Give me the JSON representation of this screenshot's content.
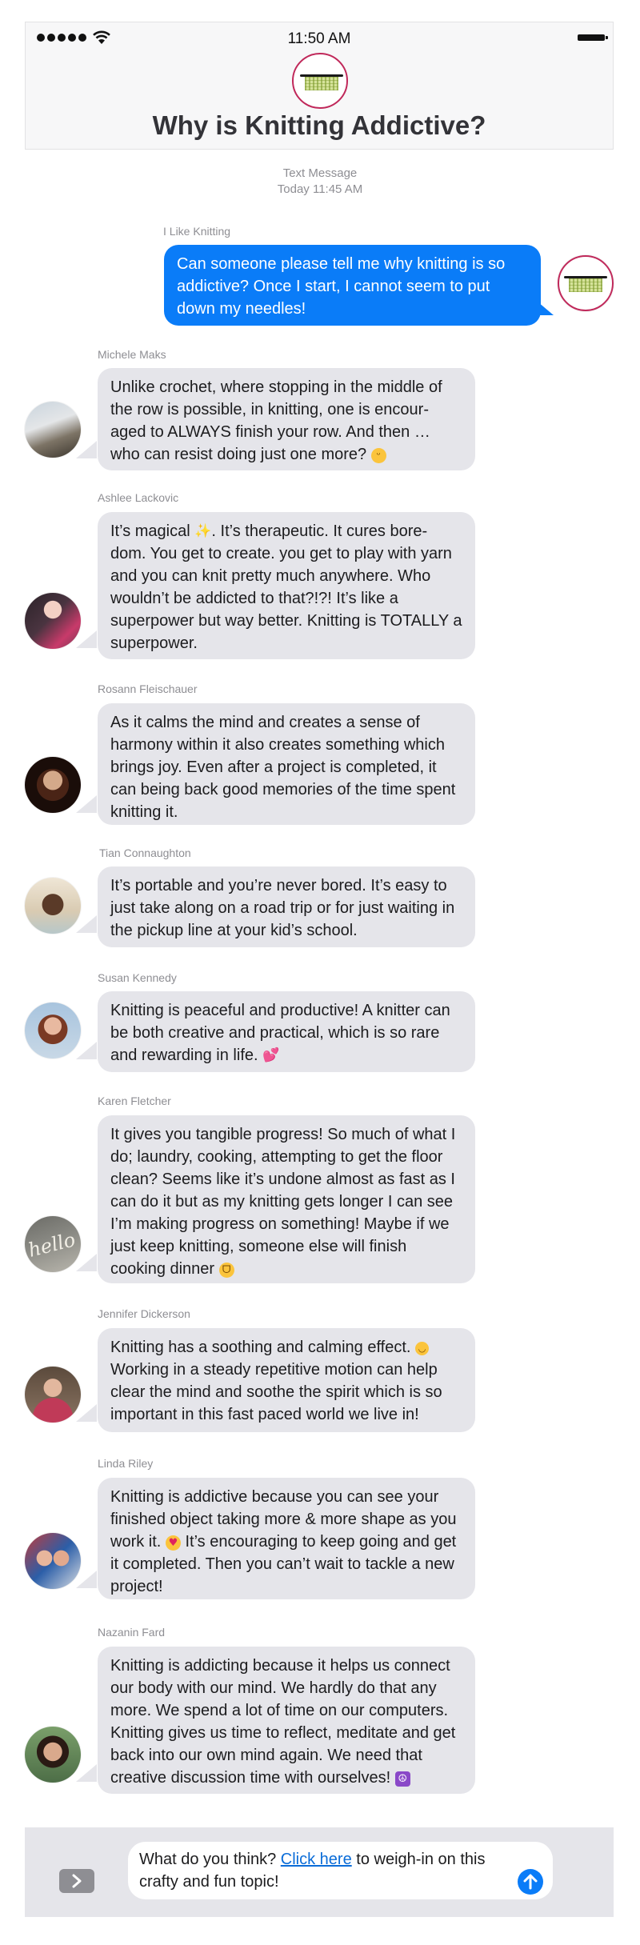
{
  "status_bar": {
    "time": "11:50 AM"
  },
  "header": {
    "title": "Why is Knitting Addictive?"
  },
  "thread_meta": {
    "type": "Text Message",
    "timestamp": "Today 11:45 AM"
  },
  "outgoing": {
    "sender": "I Like Knitting",
    "text": "Can someone please tell me why knitting is so addictive? Once I start, I cannot seem to put down my needles!"
  },
  "messages": [
    {
      "sender": "Michele Maks",
      "text": "Unlike crochet, where stopping in the middle of the row is possible, in knitting, one is encour-aged to ALWAYS finish your row. And then … who can resist doing just one more?",
      "emoji": "grinning-face"
    },
    {
      "sender": "Ashlee Lackovic",
      "text_a": "It’s magical",
      "text_b": ". It’s therapeutic. It cures bore-dom. You get to create. you get to play with yarn and you can knit pretty much anywhere. Who wouldn’t be addicted to that?!?! It’s like a superpower but way better. Knitting is TOTALLY a superpower.",
      "emoji": "sparkles"
    },
    {
      "sender": "Rosann Fleischauer",
      "text": "As it calms the mind and creates a sense of harmony within it also creates something which brings joy. Even after a project is completed, it can being back good memories of the time spent knitting it."
    },
    {
      "sender": "Tian Connaughton",
      "text": "It’s portable and you’re never bored. It’s easy to just take along on a road trip or for just waiting in the pickup line at your kid’s school."
    },
    {
      "sender": "Susan Kennedy",
      "text": "Knitting is peaceful and productive! A knitter can be both creative and practical, which is so rare and rewarding in life.",
      "emoji": "two-hearts"
    },
    {
      "sender": "Karen Fletcher",
      "text": "It gives you tangible progress! So much of what I do; laundry, cooking, attempting to get the floor clean? Seems like it’s undone almost as fast as I can do it but as my knitting gets longer I can see I’m making progress on something! Maybe if we just keep knitting, someone else will finish cooking dinner",
      "emoji": "tears-of-joy"
    },
    {
      "sender": "Jennifer Dickerson",
      "text_a": "Knitting has a soothing and calming effect.",
      "text_b": "Working in a steady repetitive motion can help clear the mind and soothe the spirit which is so important in this fast paced world we live in!",
      "emoji": "relieved-face"
    },
    {
      "sender": "Linda Riley",
      "text_a": "Knitting is addictive because you can see your finished object taking more & more shape as you work it.",
      "text_b": " It’s encouraging to keep going and get it completed. Then you can’t wait to tackle a new project!",
      "emoji": "heart-eyes"
    },
    {
      "sender": "Nazanin Fard",
      "text": "Knitting is addicting because it helps us connect our body with our mind. We hardly do that any more. We spend a lot of time on our computers. Knitting gives us time to reflect, meditate and get back into our own mind again. We need that creative discussion time with ourselves!",
      "emoji": "peace-symbol"
    }
  ],
  "composer": {
    "text_before": "What do you think? ",
    "link_text": "Click here",
    "text_after": " to weigh-in on this crafty and fun topic!",
    "expand_icon": "chevron-right-icon",
    "send_icon": "arrow-up-icon"
  },
  "colors": {
    "outgoing_bubble": "#0a7cf8",
    "incoming_bubble": "#e5e5ea",
    "accent_ring": "#c0285a"
  }
}
